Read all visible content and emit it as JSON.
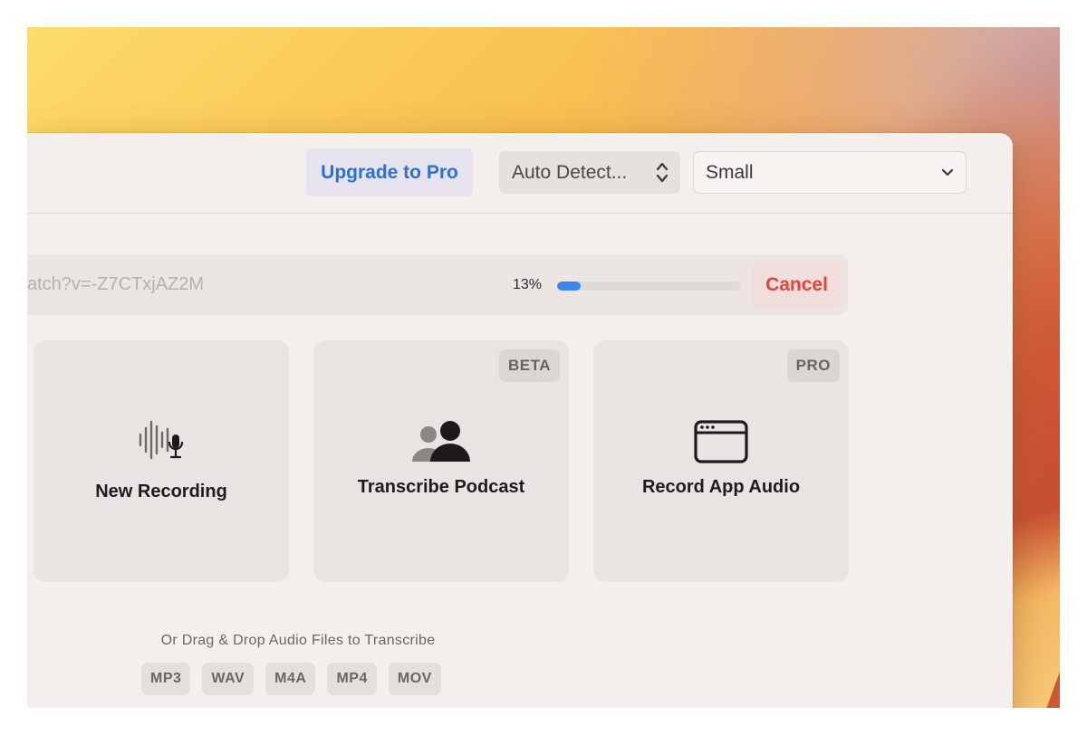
{
  "toolbar": {
    "upgrade_label": "Upgrade to Pro",
    "language_select": "Auto Detect...",
    "model_select": "Small"
  },
  "download": {
    "url": "atch?v=-Z7CTxjAZ2M",
    "progress_label": "13%",
    "progress": 0.13,
    "cancel_label": "Cancel"
  },
  "cards": {
    "new_recording": {
      "label": "New Recording",
      "icon": "waveform-mic-icon"
    },
    "transcribe_podcast": {
      "label": "Transcribe Podcast",
      "badge": "BETA",
      "icon": "people-icon"
    },
    "record_app_audio": {
      "label": "Record App Audio",
      "badge": "PRO",
      "icon": "app-window-icon"
    }
  },
  "drop_hint": "Or Drag & Drop Audio Files to Transcribe",
  "formats": [
    "MP3",
    "WAV",
    "M4A",
    "MP4",
    "MOV"
  ],
  "colors": {
    "accent_blue": "#2e6ed7",
    "progress_blue": "#3d85f0",
    "cancel_red": "#e2453b"
  }
}
